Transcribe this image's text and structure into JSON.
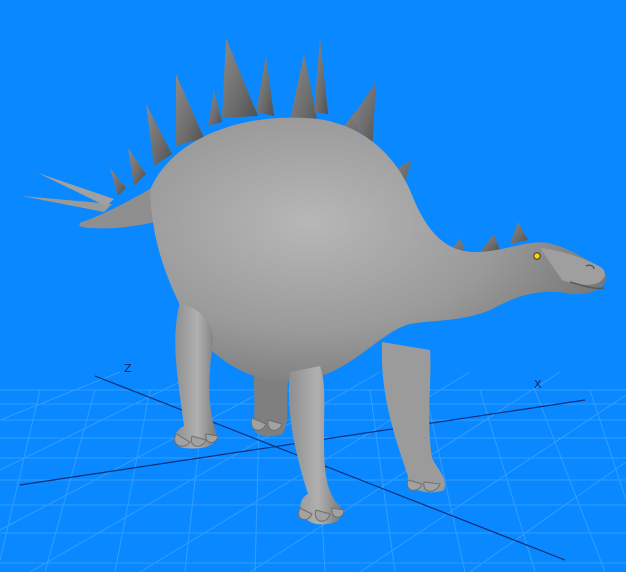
{
  "viewport": {
    "background_color": "#0a88ff",
    "grid_color": "#39a2ff",
    "grid_major_color": "#0d2f75",
    "model_color": "#8e8e8e",
    "eye_color": "#ffd200"
  },
  "axes": {
    "z_label": "Z",
    "x_label": "X"
  }
}
